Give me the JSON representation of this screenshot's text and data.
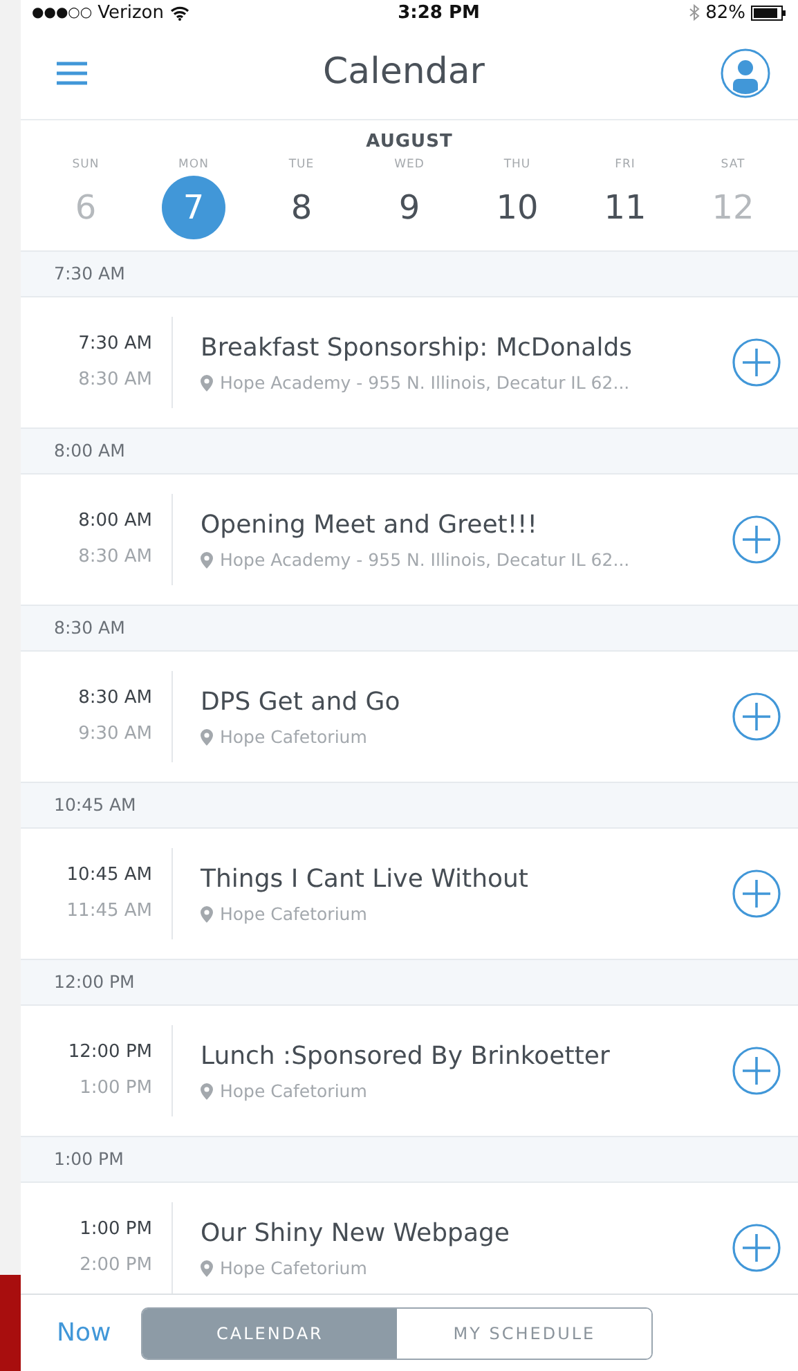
{
  "status_bar": {
    "signal": "●●●○○",
    "carrier": "Verizon",
    "time": "3:28 PM",
    "battery": "82%"
  },
  "header": {
    "title": "Calendar"
  },
  "week": {
    "month": "AUGUST",
    "days": [
      {
        "weekday": "SUN",
        "date": "6",
        "selected": false,
        "muted": true
      },
      {
        "weekday": "MON",
        "date": "7",
        "selected": true,
        "muted": false
      },
      {
        "weekday": "TUE",
        "date": "8",
        "selected": false,
        "muted": false
      },
      {
        "weekday": "WED",
        "date": "9",
        "selected": false,
        "muted": false
      },
      {
        "weekday": "THU",
        "date": "10",
        "selected": false,
        "muted": false
      },
      {
        "weekday": "FRI",
        "date": "11",
        "selected": false,
        "muted": false
      },
      {
        "weekday": "SAT",
        "date": "12",
        "selected": false,
        "muted": true
      }
    ]
  },
  "sections": [
    {
      "heading": "7:30 AM",
      "event": {
        "start": "7:30 AM",
        "end": "8:30 AM",
        "title": "Breakfast Sponsorship: McDonalds",
        "location": "Hope Academy - 955 N. Illinois, Decatur IL 62..."
      }
    },
    {
      "heading": "8:00 AM",
      "event": {
        "start": "8:00 AM",
        "end": "8:30 AM",
        "title": "Opening Meet and Greet!!!",
        "location": "Hope Academy - 955 N. Illinois, Decatur IL 62..."
      }
    },
    {
      "heading": "8:30 AM",
      "event": {
        "start": "8:30 AM",
        "end": "9:30 AM",
        "title": "DPS Get and Go",
        "location": "Hope Cafetorium"
      }
    },
    {
      "heading": "10:45 AM",
      "event": {
        "start": "10:45 AM",
        "end": "11:45 AM",
        "title": "Things I Cant Live Without",
        "location": "Hope Cafetorium"
      }
    },
    {
      "heading": "12:00 PM",
      "event": {
        "start": "12:00 PM",
        "end": "1:00 PM",
        "title": "Lunch :Sponsored By Brinkoetter",
        "location": "Hope Cafetorium"
      }
    },
    {
      "heading": "1:00 PM",
      "event": {
        "start": "1:00 PM",
        "end": "2:00 PM",
        "title": "Our Shiny New Webpage",
        "location": "Hope Cafetorium"
      }
    }
  ],
  "bottom_bar": {
    "now": "Now",
    "segments": [
      {
        "label": "CALENDAR",
        "selected": true
      },
      {
        "label": "MY SCHEDULE",
        "selected": false
      }
    ]
  }
}
